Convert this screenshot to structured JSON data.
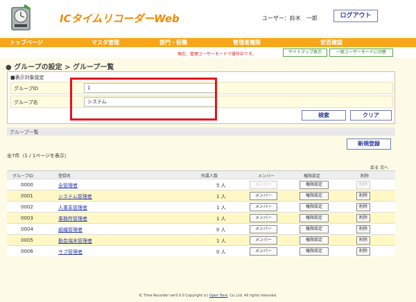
{
  "header": {
    "app_title": "ICタイムリコーダーWeb",
    "user_label": "ユーザー：鈴木　一郎",
    "logout_label": "ログアウト"
  },
  "nav": {
    "items": [
      "トップページ",
      "マスタ管理",
      "部門・役職",
      "管理者権限",
      "安否確認"
    ]
  },
  "subbar": {
    "mode_text": "現在、管理ユーザーモードで操作中です。",
    "sitemap_label": "サイトマップ表示",
    "switch_mode_label": "一般ユーザーモードに切替"
  },
  "page": {
    "breadcrumb": "● グループの設定 > グループ一覧"
  },
  "filter": {
    "section_title": "■表示対象設定",
    "group_id_label": "グループID",
    "group_id_value": "1",
    "group_name_label": "グループ名",
    "group_name_value": "システム",
    "search_label": "検索",
    "clear_label": "クリア"
  },
  "list": {
    "section_title": "グループ一覧",
    "new_label": "新規登録",
    "count_text": "全7件（1 / 1ページを表示）",
    "pager_prev": "戻る",
    "pager_next": "次へ",
    "columns": [
      "グループID",
      "登録名",
      "所属人数",
      "メンバー",
      "権限設定",
      "削除"
    ],
    "rows": [
      {
        "id": "0000",
        "name": "全管理者",
        "count": "5 人",
        "member": "メンバー",
        "perm": "権限設定",
        "del": "削除",
        "disabled": true
      },
      {
        "id": "0001",
        "name": "システム管理者",
        "count": "1 人",
        "member": "メンバー",
        "perm": "権限設定",
        "del": "削除",
        "disabled": false
      },
      {
        "id": "0002",
        "name": "人事系管理者",
        "count": "1 人",
        "member": "メンバー",
        "perm": "権限設定",
        "del": "削除",
        "disabled": false
      },
      {
        "id": "0003",
        "name": "事務所管理者",
        "count": "1 人",
        "member": "メンバー",
        "perm": "権限設定",
        "del": "削除",
        "disabled": false
      },
      {
        "id": "0004",
        "name": "組織管理者",
        "count": "0 人",
        "member": "メンバー",
        "perm": "権限設定",
        "del": "削除",
        "disabled": false
      },
      {
        "id": "0005",
        "name": "勤怠端末管理者",
        "count": "1 人",
        "member": "メンバー",
        "perm": "権限設定",
        "del": "削除",
        "disabled": false
      },
      {
        "id": "0006",
        "name": "サブ管理者",
        "count": "0 人",
        "member": "メンバー",
        "perm": "権限設定",
        "del": "削除",
        "disabled": false
      }
    ]
  },
  "footer": {
    "prefix": "IC Time Recorder ver5.0.0 Copyright (c) ",
    "link": "Open Tone",
    "suffix": ", Co.,Ltd. All rights reserved."
  },
  "colors": {
    "accent_orange": "#f7a519",
    "title_orange": "#f08a00",
    "alert_red": "#e4141b",
    "link_blue": "#2a3aa8",
    "row_yellow": "#fff8c5"
  }
}
